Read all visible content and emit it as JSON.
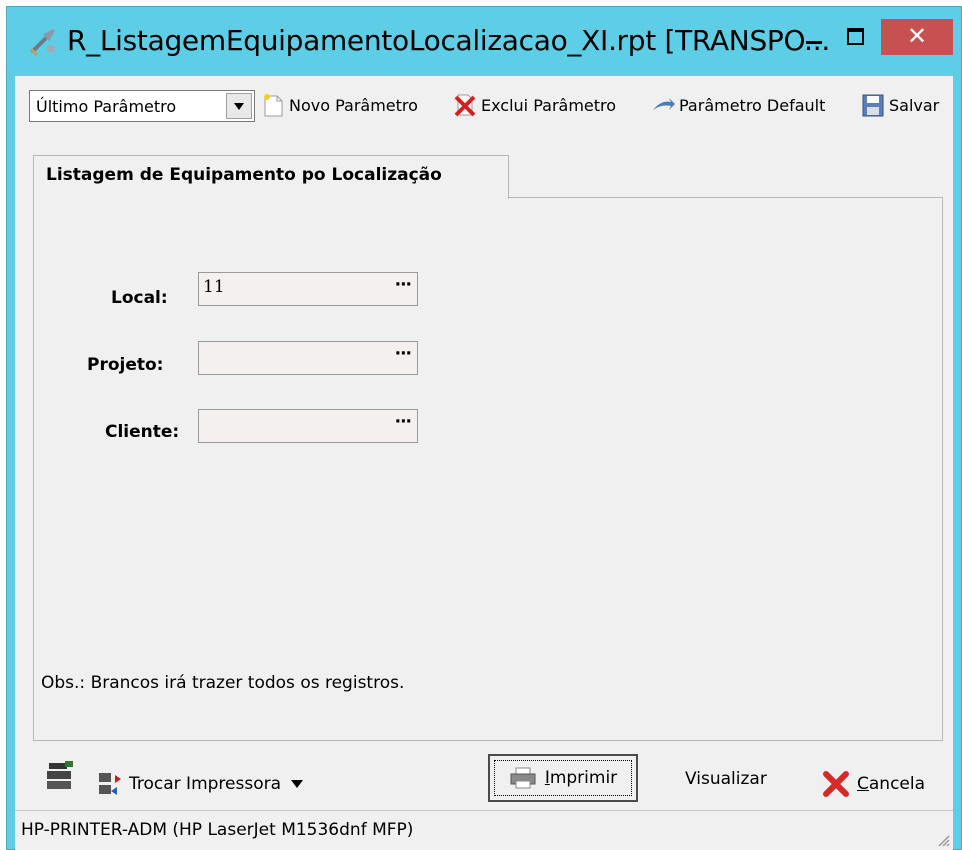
{
  "window": {
    "title": "R_ListagemEquipamentoLocalizacao_XI.rpt [TRANSPO...",
    "close_glyph": "✕"
  },
  "toolbar": {
    "parameter_select": "Último Parâmetro",
    "new_param": "Novo Parâmetro",
    "delete_param": "Exclui Parâmetro",
    "default_param": "Parâmetro Default",
    "save": "Salvar"
  },
  "tabs": [
    {
      "label": "Listagem de Equipamento po Localização",
      "active": true
    }
  ],
  "form": {
    "local": {
      "label": "Local:",
      "value": "11",
      "lookup": "···"
    },
    "projeto": {
      "label": "Projeto:",
      "value": "",
      "lookup": "···"
    },
    "cliente": {
      "label": "Cliente:",
      "value": "",
      "lookup": "···"
    },
    "note": "Obs.: Brancos irá trazer todos os registros."
  },
  "actions": {
    "change_printer": "Trocar Impressora",
    "print": "Imprimir",
    "preview": "Visualizar",
    "cancel": "Cancela"
  },
  "status": {
    "printer": "HP-PRINTER-ADM (HP LaserJet M1536dnf MFP)"
  },
  "colors": {
    "titlebar": "#5ecde6",
    "close_button": "#c75050",
    "client_bg": "#f0f0f0"
  },
  "icons": [
    "tools-icon",
    "new-document-icon",
    "delete-x-icon",
    "arrow-icon",
    "floppy-disk-icon",
    "printer-settings-icon",
    "swap-printer-icon",
    "printer-icon",
    "red-x-icon"
  ]
}
